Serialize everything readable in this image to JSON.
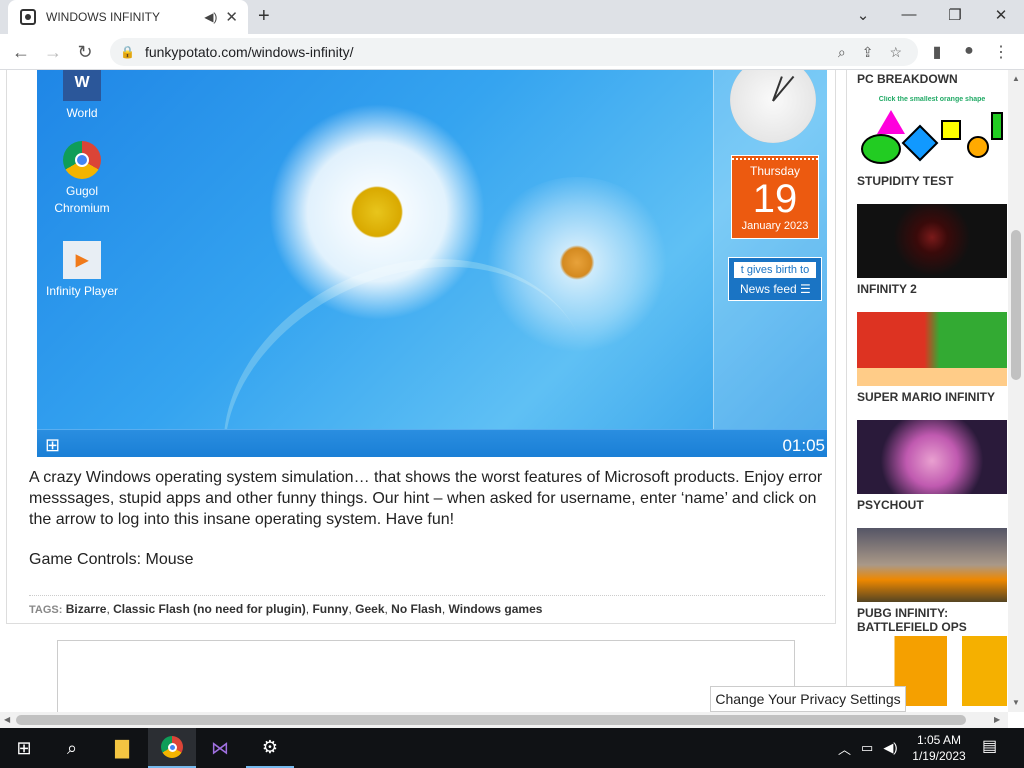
{
  "browser": {
    "tab_title": "WINDOWS INFINITY",
    "url": "funkypotato.com/windows-infinity/"
  },
  "game": {
    "desktop_icons": [
      {
        "label": "World"
      },
      {
        "label": "Gugol Chromium"
      },
      {
        "label": "Infinity Player"
      }
    ],
    "calendar": {
      "weekday": "Thursday",
      "day": "19",
      "month_year": "January 2023"
    },
    "feed": {
      "ticker": "t gives birth to",
      "label": "News feed"
    },
    "time": "01:05"
  },
  "article": {
    "description": "A crazy Windows operating system simulation… that shows the worst features of Microsoft products. Enjoy error messsages, stupid apps and other funny things. Our hint – when asked for username, enter ‘name’ and click on the arrow to log into this insane operating system. Have fun!",
    "controls": "Game Controls: Mouse",
    "tags_label": "TAGS:",
    "tags": [
      "Bizarre",
      "Classic Flash (no need for plugin)",
      "Funny",
      "Geek",
      "No Flash",
      "Windows games"
    ]
  },
  "sidebar": {
    "games": [
      {
        "title": "PC BREAKDOWN"
      },
      {
        "title": "STUPIDITY TEST",
        "thumb_text": "Click the smallest orange shape"
      },
      {
        "title": "INFINITY 2"
      },
      {
        "title": "SUPER MARIO INFINITY"
      },
      {
        "title": "PSYCHOUT"
      },
      {
        "title": "PUBG INFINITY: BATTLEFIELD OPS"
      },
      {
        "title": ""
      }
    ]
  },
  "privacy": {
    "label": "Change Your Privacy Settings"
  },
  "taskbar": {
    "time": "1:05 AM",
    "date": "1/19/2023"
  }
}
